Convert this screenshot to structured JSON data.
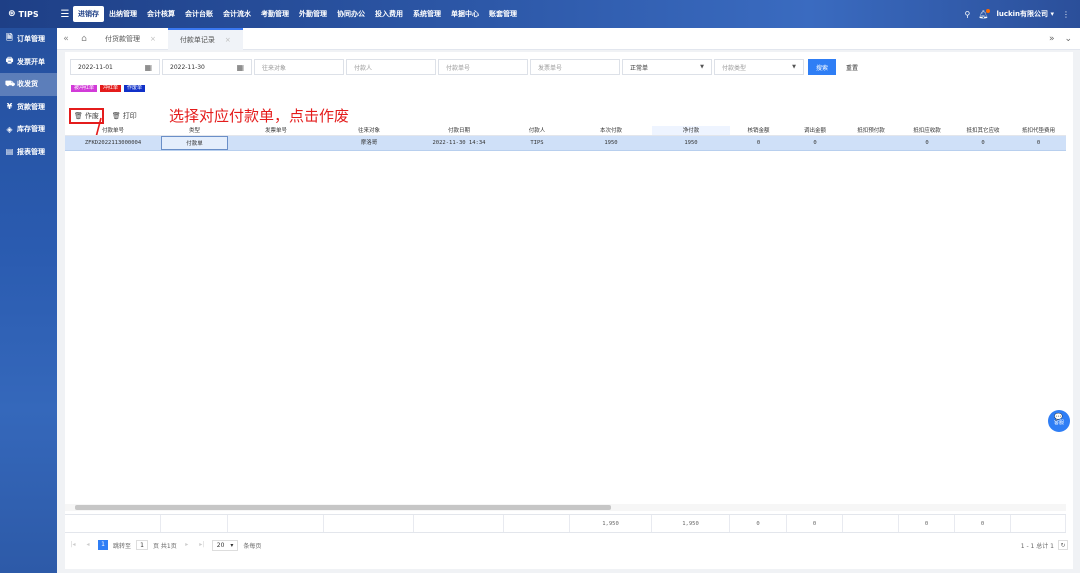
{
  "app": {
    "logo": "TIPS"
  },
  "topnav": [
    "进销存",
    "出纳管理",
    "会计核算",
    "会计台账",
    "会计流水",
    "考勤管理",
    "外勤管理",
    "协同办公",
    "投入费用",
    "系统管理",
    "单据中心",
    "账套管理"
  ],
  "user": {
    "name": "luckin有限公司 ▾"
  },
  "sidebar": [
    {
      "icon": "🗎",
      "label": "订单管理"
    },
    {
      "icon": "🖶",
      "label": "发票开单"
    },
    {
      "icon": "⛟",
      "label": "收发货"
    },
    {
      "icon": "¥",
      "label": "货款管理"
    },
    {
      "icon": "◈",
      "label": "库存管理"
    },
    {
      "icon": "▤",
      "label": "报表管理"
    }
  ],
  "tabs": [
    {
      "label": "付货款管理",
      "close": "×"
    },
    {
      "label": "付款单记录",
      "close": "×"
    }
  ],
  "filters": {
    "date_start": "2022-11-01",
    "date_end": "2022-11-30",
    "partner_ph": "往来对象",
    "payer_ph": "付款人",
    "payno_ph": "付款单号",
    "invno_ph": "发票单号",
    "doctype": "正常单",
    "paytype_ph": "付款类型",
    "search": "搜索",
    "reset": "重置"
  },
  "legend": [
    {
      "label": "被冲红单",
      "color": "#d23bd8"
    },
    {
      "label": "冲红单",
      "color": "#e41c1c"
    },
    {
      "label": "作废单",
      "color": "#1030c8"
    }
  ],
  "toolbar": {
    "void": "作废",
    "print": "打印"
  },
  "annotation": "选择对应付款单，点击作废",
  "columns": [
    "付款单号",
    "类型",
    "发票单号",
    "往来对象",
    "付款日期",
    "付款人",
    "本次付款",
    "净付款",
    "核销金额",
    "调出金额",
    "抵扣预付款",
    "抵扣应收款",
    "抵扣其它应收",
    "抵扣代垫费用"
  ],
  "rows": [
    [
      "ZFKD2022113000004",
      "付款单",
      "",
      "摩洛哥",
      "2022-11-30 14:34",
      "TIPS",
      "1950",
      "1950",
      "0",
      "0",
      "",
      "0",
      "0",
      "0"
    ]
  ],
  "totals": [
    "",
    "",
    "",
    "",
    "",
    "",
    "1,950",
    "1,950",
    "0",
    "0",
    "",
    "0",
    "0",
    ""
  ],
  "pager": {
    "current": "1",
    "goto_label": "跳转至",
    "goto_value": "1",
    "page_label": "页 共1页",
    "size": "20",
    "size_label": "条每页",
    "summary": "1 - 1 总计 1"
  },
  "kefu": "客服"
}
